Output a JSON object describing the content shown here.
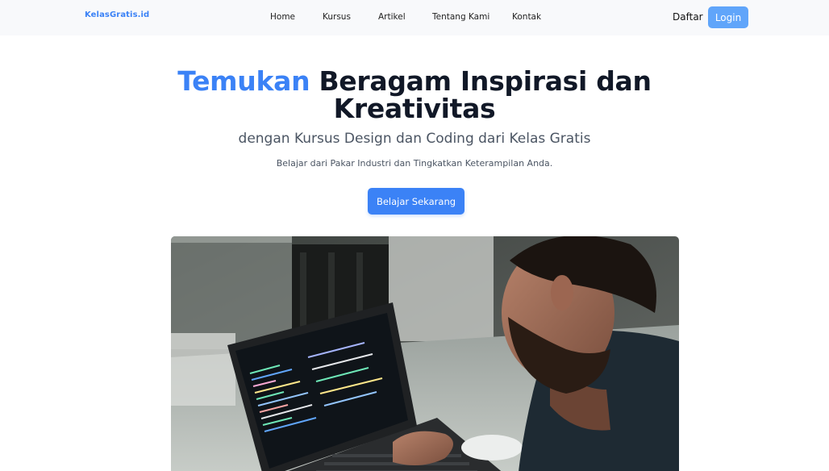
{
  "nav": {
    "brand": "KelasGratis.id",
    "links": [
      "Home",
      "Kursus",
      "Artikel",
      "Tentang Kami",
      "Kontak"
    ],
    "daftar": "Daftar",
    "login": "Login"
  },
  "hero": {
    "title_accent": "Temukan",
    "title_rest_line1": " Beragam Inspirasi dan",
    "title_line2": "Kreativitas",
    "subtitle": "dengan Kursus Design dan Coding dari Kelas Gratis",
    "description": "Belajar dari Pakar Industri dan Tingkatkan Keterampilan Anda.",
    "cta": "Belajar Sekarang"
  },
  "colors": {
    "accent": "#3b82f6",
    "login_button": "#60a5fa",
    "navbar_bg": "#f8f9fb"
  }
}
